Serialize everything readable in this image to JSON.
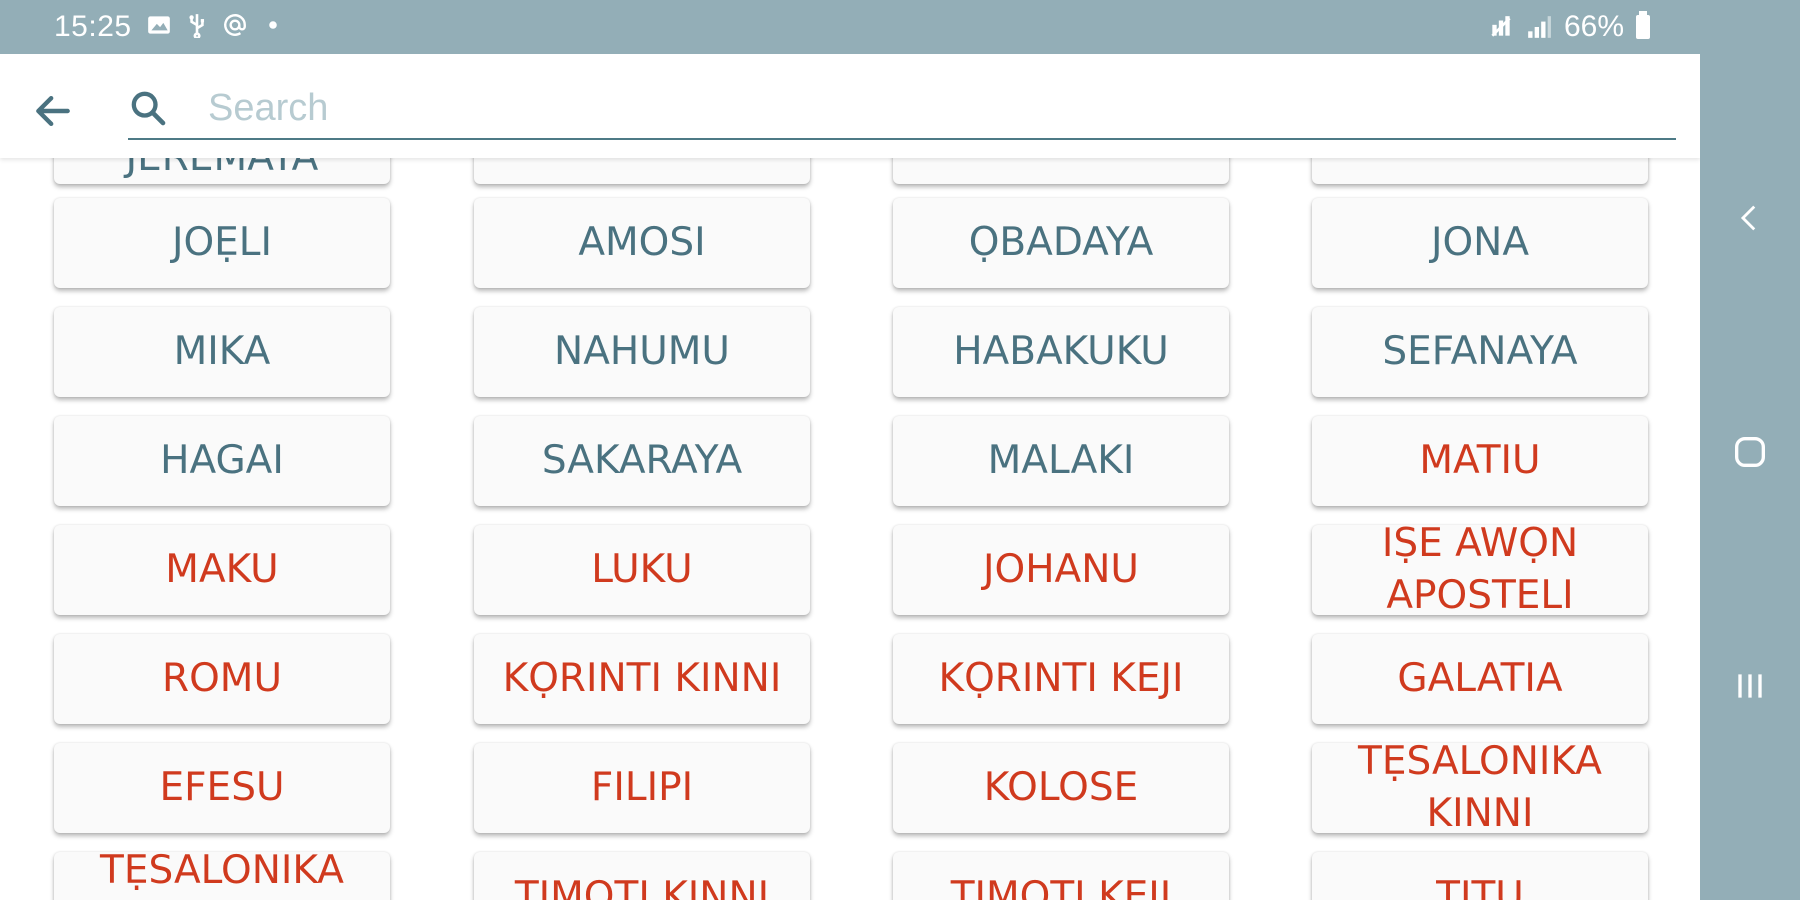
{
  "status_bar": {
    "time": "15:25",
    "left_icons": [
      "image-icon",
      "usb-icon",
      "at-icon",
      "dot-icon"
    ],
    "right_icons": [
      "mute-icon",
      "signal-icon"
    ],
    "battery": "66%"
  },
  "search": {
    "placeholder": "Search",
    "value": ""
  },
  "colors": {
    "old_testament": "#4a7280",
    "new_testament": "#d03a1e",
    "chrome": "#93aeb7"
  },
  "books": {
    "row0": [
      {
        "label": "JEREMAYA",
        "testament": "old"
      },
      {
        "label": "",
        "testament": "old"
      },
      {
        "label": "",
        "testament": "old"
      },
      {
        "label": "",
        "testament": "old"
      }
    ],
    "row1": [
      {
        "label": "JOẸLI",
        "testament": "old"
      },
      {
        "label": "AMOSI",
        "testament": "old"
      },
      {
        "label": "ỌBADAYA",
        "testament": "old"
      },
      {
        "label": "JONA",
        "testament": "old"
      }
    ],
    "row2": [
      {
        "label": "MIKA",
        "testament": "old"
      },
      {
        "label": "NAHUMU",
        "testament": "old"
      },
      {
        "label": "HABAKUKU",
        "testament": "old"
      },
      {
        "label": "SEFANAYA",
        "testament": "old"
      }
    ],
    "row3": [
      {
        "label": "HAGAI",
        "testament": "old"
      },
      {
        "label": "SAKARAYA",
        "testament": "old"
      },
      {
        "label": "MALAKI",
        "testament": "old"
      },
      {
        "label": "MATIU",
        "testament": "new"
      }
    ],
    "row4": [
      {
        "label": "MAKU",
        "testament": "new"
      },
      {
        "label": "LUKU",
        "testament": "new"
      },
      {
        "label": "JOHANU",
        "testament": "new"
      },
      {
        "label": "ÌṢE ÀWỌN APOSTELI",
        "testament": "new"
      }
    ],
    "row5": [
      {
        "label": "ROMU",
        "testament": "new"
      },
      {
        "label": "KỌRINTI KINNI",
        "testament": "new"
      },
      {
        "label": "KỌRINTI KEJI",
        "testament": "new"
      },
      {
        "label": "GALATIA",
        "testament": "new"
      }
    ],
    "row6": [
      {
        "label": "EFESU",
        "testament": "new"
      },
      {
        "label": "FILIPI",
        "testament": "new"
      },
      {
        "label": "KOLOSE",
        "testament": "new"
      },
      {
        "label": "TẸSALONIKA KINNI",
        "testament": "new"
      }
    ],
    "row7": [
      {
        "label": "TẸSALONIKA KEJI",
        "testament": "new"
      },
      {
        "label": "TIMOTI KINNI",
        "testament": "new"
      },
      {
        "label": "TIMOTI KEJI",
        "testament": "new"
      },
      {
        "label": "TITU",
        "testament": "new"
      }
    ]
  },
  "nav_bar": {
    "buttons": [
      "back-nav-icon",
      "home-nav-icon",
      "recents-nav-icon"
    ]
  }
}
